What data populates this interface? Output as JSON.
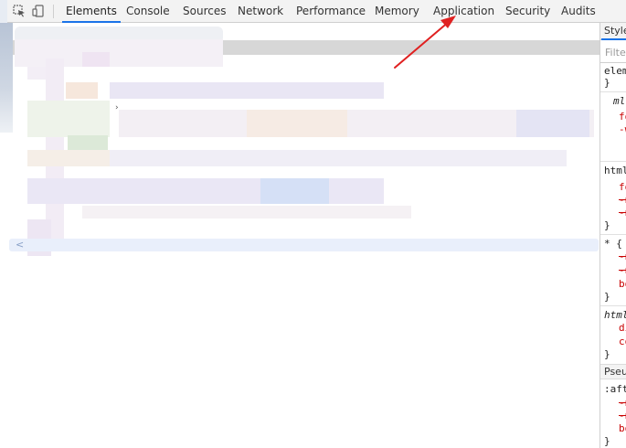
{
  "toolbar": {
    "inspect_icon": "inspect-element-icon",
    "device_icon": "device-toolbar-icon",
    "tabs": [
      {
        "label": "Elements",
        "active": true
      },
      {
        "label": "Console"
      },
      {
        "label": "Sources"
      },
      {
        "label": "Network"
      },
      {
        "label": "Performance"
      },
      {
        "label": "Memory"
      },
      {
        "label": "Application"
      },
      {
        "label": "Security"
      },
      {
        "label": "Audits"
      }
    ]
  },
  "styles": {
    "tab_label": "Styles",
    "filter_placeholder": "Filter",
    "element_style": "element.style {",
    "close_brace": "}",
    "rules": [
      {
        "selector": "ml",
        "lines": [
          "fo",
          "-w"
        ]
      },
      {
        "selector": "html",
        "lines": [
          "fo",
          "-n",
          "-n"
        ]
      },
      {
        "selector": "* {",
        "lines": [
          "-n",
          "-n",
          "bo"
        ]
      },
      {
        "selector": "html",
        "lines": [
          "di",
          "co"
        ]
      }
    ],
    "pseudo_header": "Pseudo",
    "pseudo_selector": ":after",
    "pseudo_lines": [
      "-n",
      "-n",
      "bo"
    ]
  },
  "colors": {
    "accent": "#1a73e8",
    "arrow": "#e02020",
    "property": "#c80000",
    "selection_row": "#e9effb"
  }
}
